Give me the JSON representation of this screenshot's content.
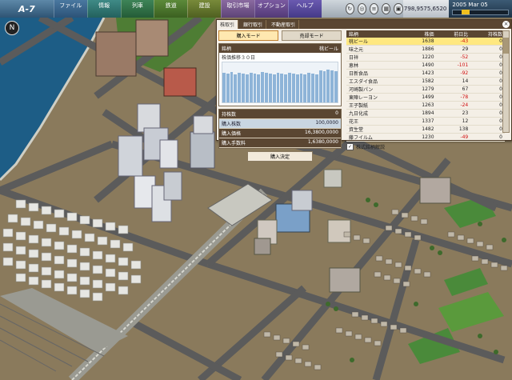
{
  "topbar": {
    "logo": "A-7",
    "menu": [
      "ファイル",
      "情報",
      "列車",
      "鉄道",
      "建設",
      "取引市場",
      "オプション",
      "ヘルプ"
    ],
    "tools": [
      "rotate-icon",
      "zoom-icon",
      "layers-icon",
      "building-icon",
      "map-icon",
      "settings-icon"
    ],
    "money": "798,9575,6520",
    "date": "2005 Mar 05",
    "date_progress": 0.15
  },
  "panel": {
    "tabs": [
      "株取引",
      "銀行取引",
      "不動産取引"
    ],
    "close": "×",
    "mode_buttons": [
      "購入モード",
      "売却モード"
    ],
    "chart": {
      "header_left": "銘柄",
      "header_right": "桃ビール",
      "subtitle": "株価推移３０日"
    },
    "info": [
      {
        "label": "持株数",
        "value": "0",
        "style": "dark"
      },
      {
        "label": "購入株数",
        "value": "100,0000",
        "style": "mid"
      },
      {
        "label": "購入価格",
        "value": "16,3800,0000",
        "style": "dark"
      },
      {
        "label": "購入手数料",
        "value": "1,6380,0000",
        "style": "dark"
      }
    ],
    "confirm": "購入決定",
    "columns": [
      "銘柄",
      "株価",
      "前日比",
      "持株数"
    ],
    "rows": [
      {
        "name": "桃ビール",
        "price": "1638",
        "change": "-43",
        "held": "0",
        "selected": true
      },
      {
        "name": "味之元",
        "price": "1886",
        "change": "29",
        "held": "0"
      },
      {
        "name": "日祥",
        "price": "1220",
        "change": "-52",
        "held": "0"
      },
      {
        "name": "恵林",
        "price": "1490",
        "change": "-101",
        "held": "0"
      },
      {
        "name": "日新食品",
        "price": "1423",
        "change": "-92",
        "held": "0"
      },
      {
        "name": "エスダイ食品",
        "price": "1582",
        "change": "14",
        "held": "0"
      },
      {
        "name": "河崎製パン",
        "price": "1279",
        "change": "67",
        "held": "0"
      },
      {
        "name": "東陣レーヨン",
        "price": "1499",
        "change": "-78",
        "held": "0"
      },
      {
        "name": "王子製紙",
        "price": "1263",
        "change": "-24",
        "held": "0"
      },
      {
        "name": "九日化成",
        "price": "1894",
        "change": "23",
        "held": "0"
      },
      {
        "name": "花王",
        "price": "1337",
        "change": "12",
        "held": "0"
      },
      {
        "name": "資生堂",
        "price": "1482",
        "change": "138",
        "held": "0"
      },
      {
        "name": "藤フイルム",
        "price": "1230",
        "change": "-49",
        "held": "0"
      }
    ],
    "checkbox_label": "株式銘柄解説",
    "checkbox_mark": "✓"
  },
  "compass": "N",
  "colors": {
    "water": "#1d5d86",
    "ground": "#8a7a5c",
    "road": "#5b5b5b",
    "negative": "#d01010"
  }
}
